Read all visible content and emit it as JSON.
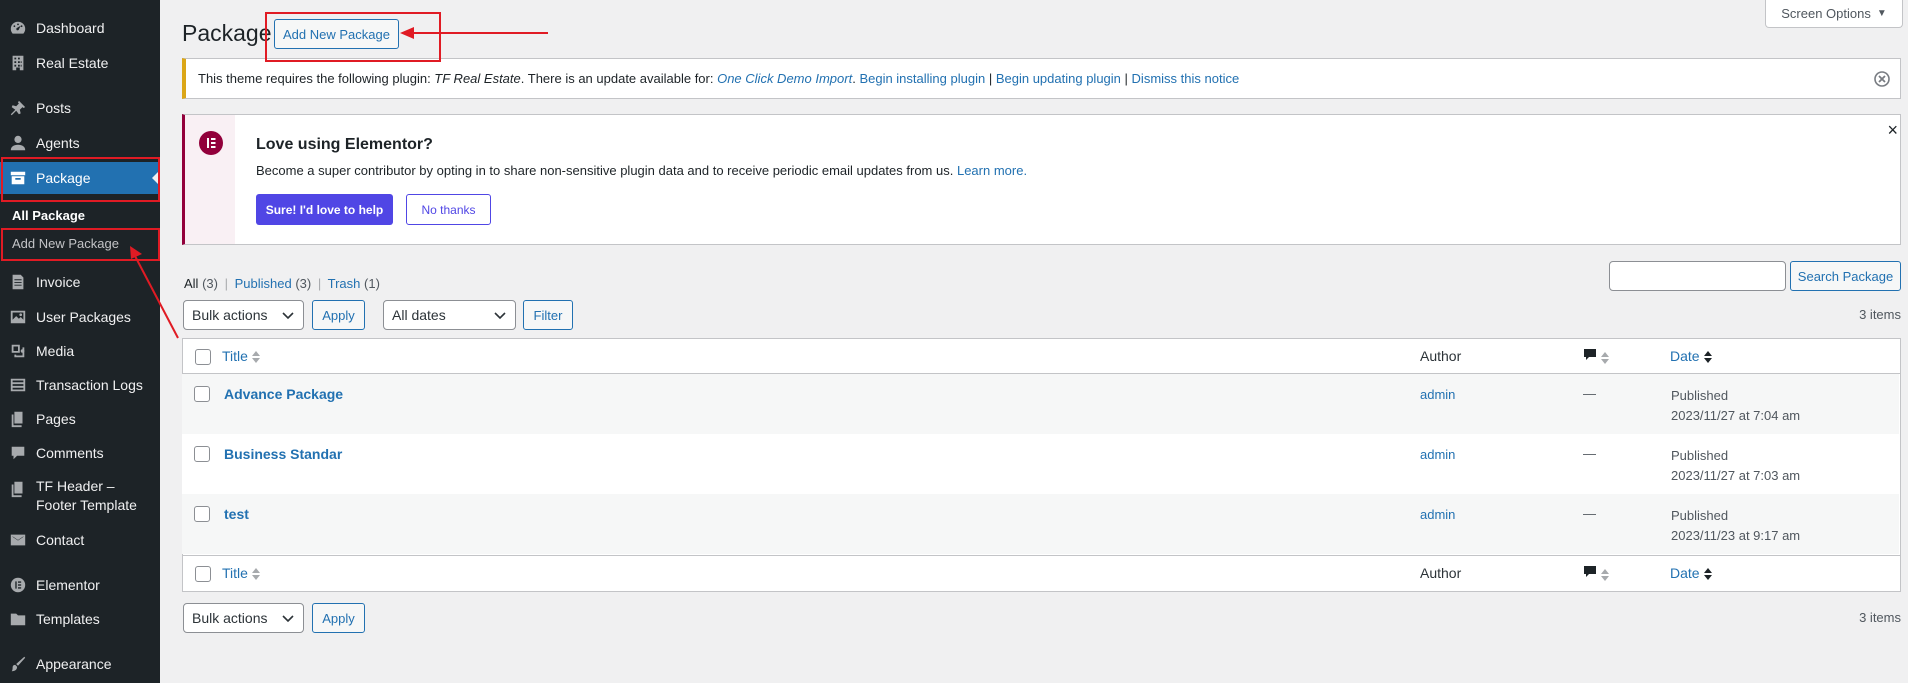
{
  "sidebar": {
    "dashboard": "Dashboard",
    "real_estate": "Real Estate",
    "posts": "Posts",
    "agents": "Agents",
    "package": "Package",
    "submenu_all": "All Package",
    "submenu_add": "Add New Package",
    "invoice": "Invoice",
    "user_packages": "User Packages",
    "media": "Media",
    "transaction_logs": "Transaction Logs",
    "pages": "Pages",
    "comments": "Comments",
    "tf_header_line1": "TF Header –",
    "tf_header_line2": "Footer Template",
    "contact": "Contact",
    "elementor": "Elementor",
    "templates": "Templates",
    "appearance": "Appearance"
  },
  "header": {
    "page_title": "Package",
    "add_new_button": "Add New Package",
    "screen_options": "Screen Options"
  },
  "plugin_notice": {
    "text_prefix": "This theme requires the following plugin: ",
    "plugin_name": "TF Real Estate",
    "text_middle": ". There is an update available for: ",
    "update_plugin": "One Click Demo Import",
    "dot": ".",
    "begin_installing": "Begin installing plugin",
    "sep1": "|",
    "begin_updating": "Begin updating plugin",
    "sep2": "|",
    "dismiss": "Dismiss this notice"
  },
  "elementor_notice": {
    "title": "Love using Elementor?",
    "body": "Become a super contributor by opting in to share non-sensitive plugin data and to receive periodic email updates from us.",
    "learn_more": "Learn more.",
    "yes_button": "Sure! I'd love to help",
    "no_button": "No thanks",
    "close": "×"
  },
  "filters": {
    "all_label": "All",
    "all_count": "(3)",
    "sep1": "|",
    "published_label": "Published",
    "published_count": "(3)",
    "sep2": "|",
    "trash_label": "Trash",
    "trash_count": "(1)",
    "search_button": "Search Package",
    "search_value": "",
    "bulk_actions": "Bulk actions",
    "apply": "Apply",
    "all_dates": "All dates",
    "filter": "Filter",
    "items_count": "3 items"
  },
  "table": {
    "columns": {
      "title": "Title",
      "author": "Author",
      "date": "Date"
    },
    "rows": [
      {
        "title": "Advance Package",
        "author": "admin",
        "comments": "—",
        "status": "Published",
        "date": "2023/11/27 at 7:04 am"
      },
      {
        "title": "Business Standar",
        "author": "admin",
        "comments": "—",
        "status": "Published",
        "date": "2023/11/27 at 7:03 am"
      },
      {
        "title": "test",
        "author": "admin",
        "comments": "—",
        "status": "Published",
        "date": "2023/11/23 at 9:17 am"
      }
    ]
  },
  "bottom": {
    "bulk_actions": "Bulk actions",
    "apply": "Apply",
    "items_count": "3 items"
  },
  "colors": {
    "sidebar_bg": "#1d2327",
    "active_menu": "#2271b1",
    "link": "#2271b1",
    "highlight_annotation": "#e01b24",
    "warning_border": "#dba617",
    "elementor_brand": "#92003b",
    "elementor_button": "#5046e5"
  }
}
